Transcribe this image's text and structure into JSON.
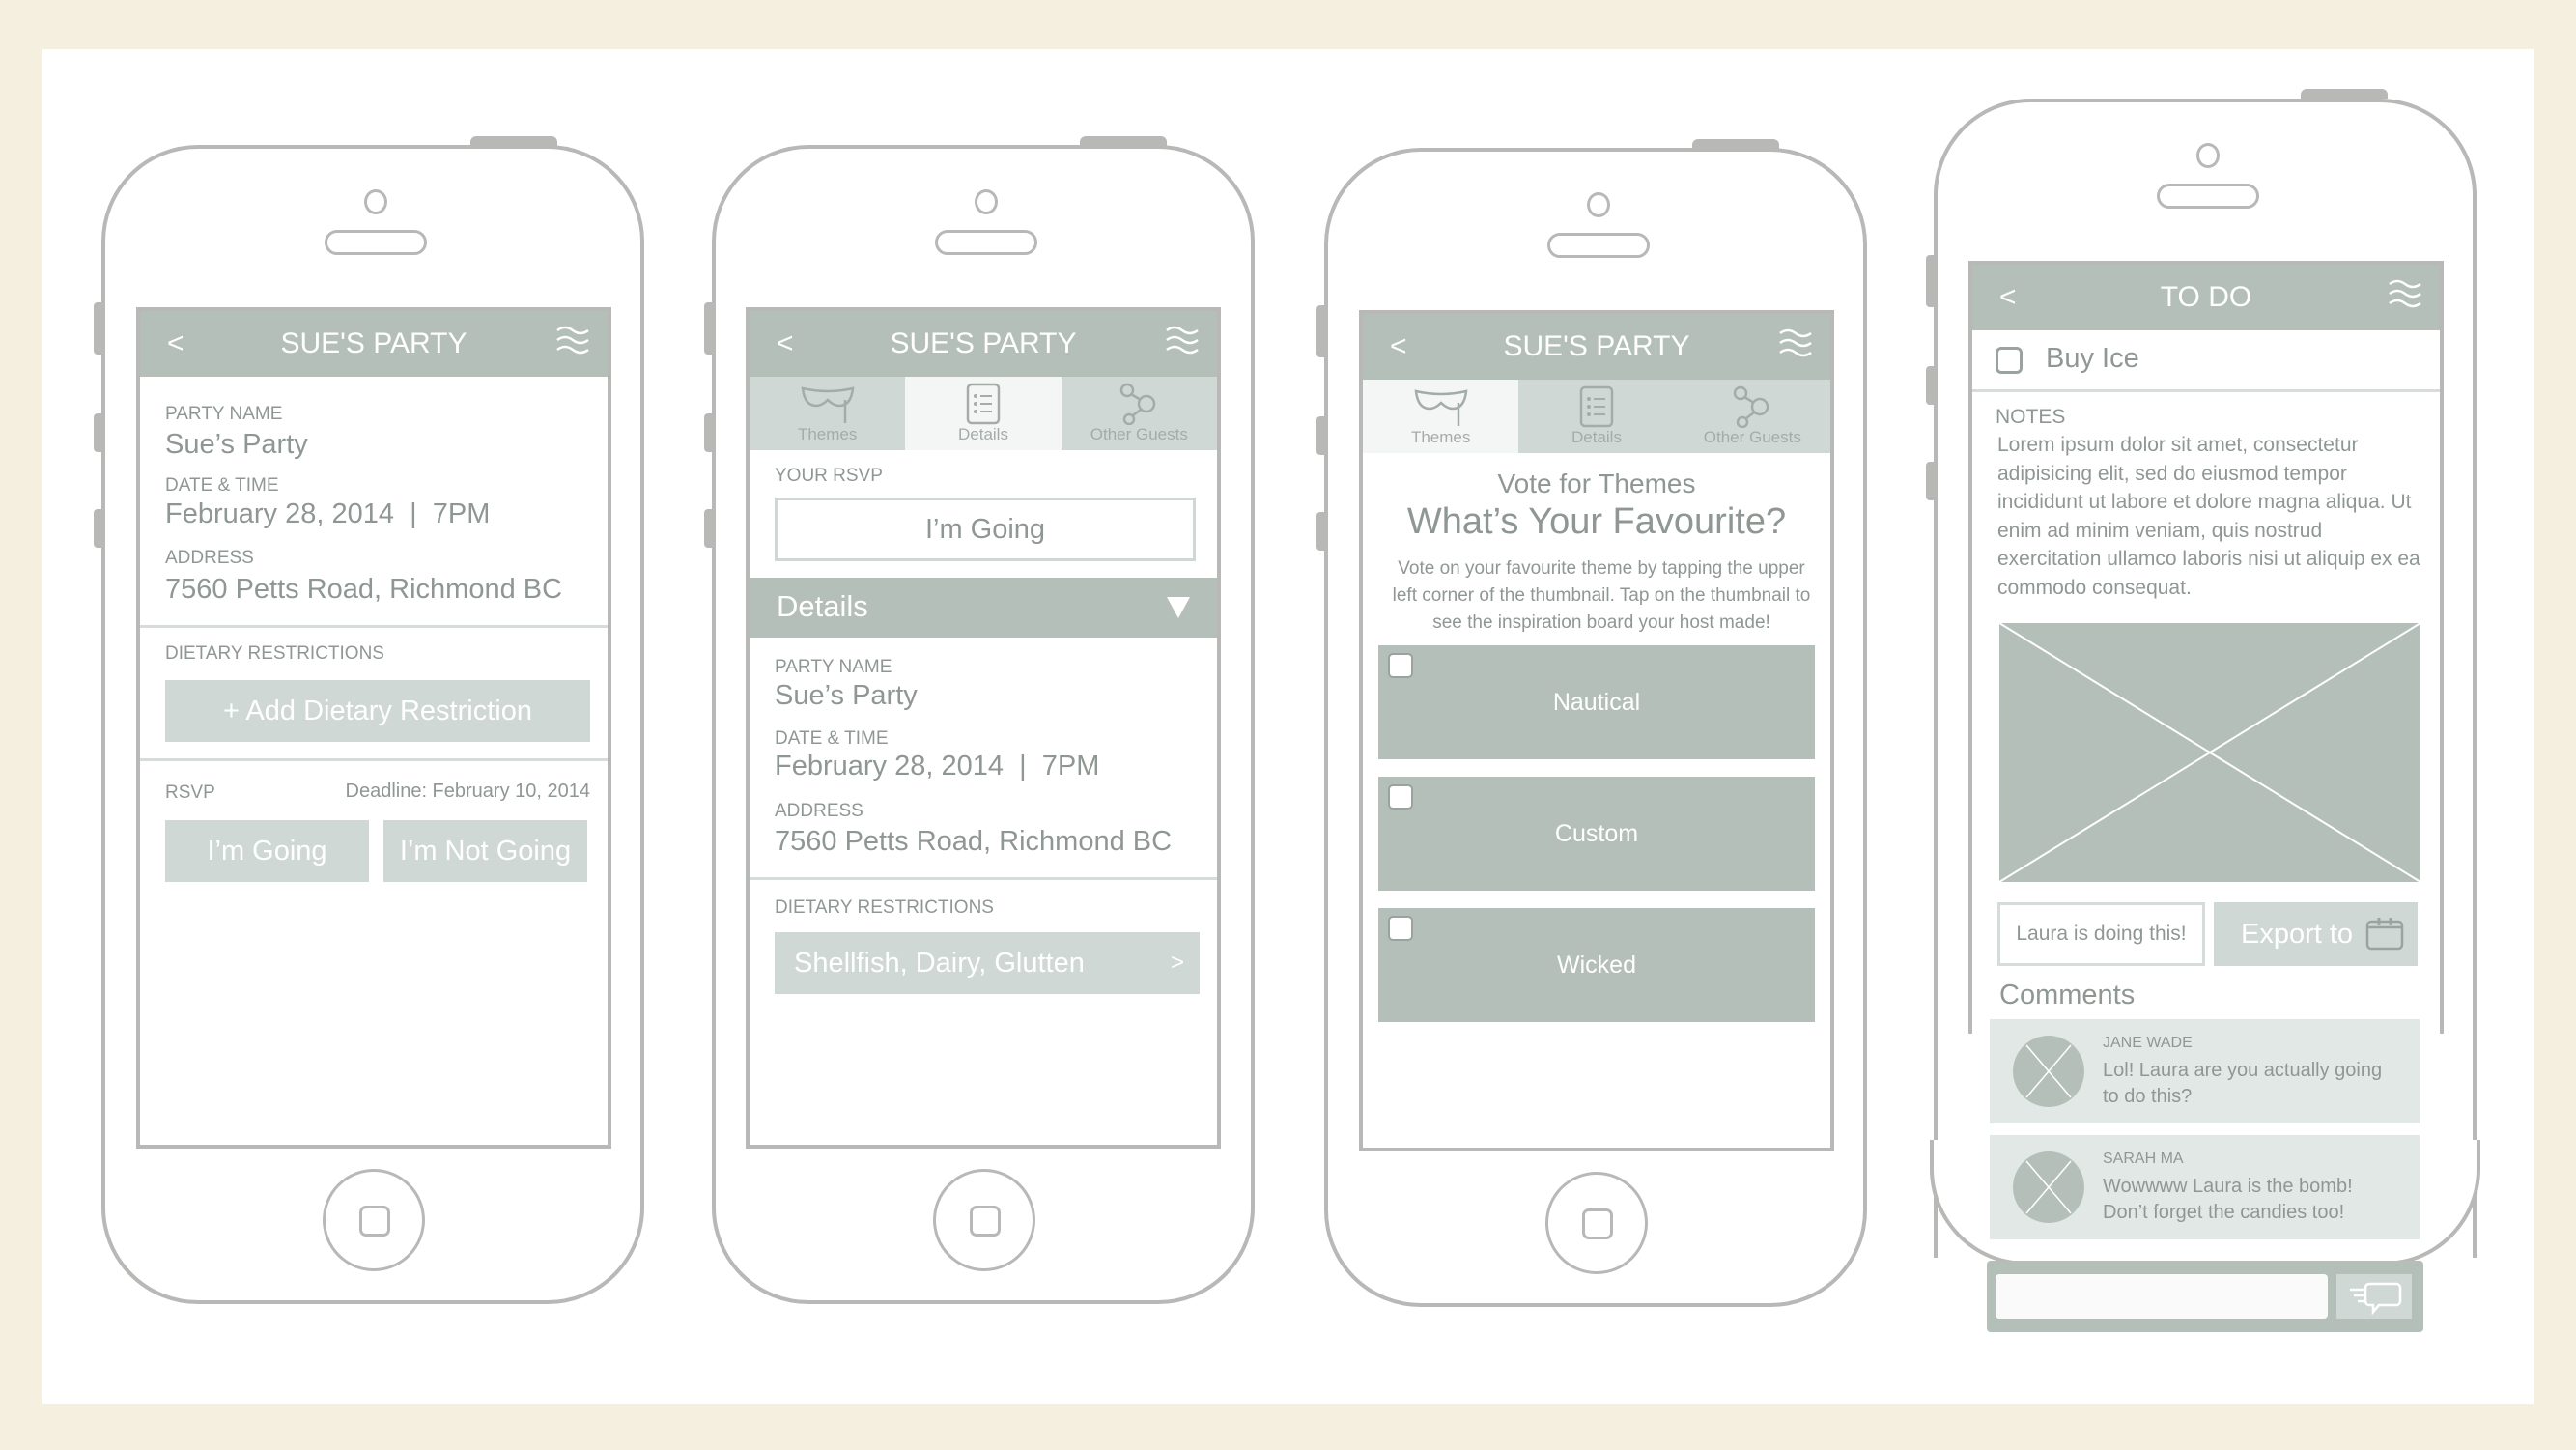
{
  "colors": {
    "background": "#f4efdf",
    "panel": "#ffffff",
    "accent": "#b5bfb9",
    "accent_light": "#d0d8d5",
    "text": "#8f9793",
    "frame": "#b8b8b6"
  },
  "phone1": {
    "header": {
      "title": "SUE'S PARTY",
      "back_icon": "chevron-left",
      "menu_icon": "waves-menu"
    },
    "party_name_label": "PARTY NAME",
    "party_name": "Sue’s Party",
    "date_label": "DATE & TIME",
    "date": "February 28, 2014  |  7PM",
    "address_label": "ADDRESS",
    "address": "7560 Petts Road, Richmond BC",
    "dietary_label": "DIETARY RESTRICTIONS",
    "add_dietary": "+ Add Dietary Restriction",
    "rsvp_label": "RSVP",
    "deadline": "Deadline: February 10, 2014",
    "going": "I’m Going",
    "not_going": "I’m Not Going"
  },
  "phone2": {
    "header": {
      "title": "SUE'S PARTY"
    },
    "tabs": [
      {
        "label": "Themes",
        "icon": "mask"
      },
      {
        "label": "Details",
        "icon": "list"
      },
      {
        "label": "Other Guests",
        "icon": "share-nodes"
      }
    ],
    "active_tab": "Details",
    "rsvp_label": "YOUR RSVP",
    "rsvp_value": "I’m Going",
    "section_title": "Details",
    "party_name_label": "PARTY NAME",
    "party_name": "Sue’s Party",
    "date_label": "DATE & TIME",
    "date": "February 28, 2014  |  7PM",
    "address_label": "ADDRESS",
    "address": "7560 Petts Road, Richmond BC",
    "dietary_label": "DIETARY RESTRICTIONS",
    "dietary_value": "Shellfish, Dairy, Glutten",
    "chevron": ">"
  },
  "phone3": {
    "header": {
      "title": "SUE'S PARTY"
    },
    "tabs": [
      {
        "label": "Themes",
        "icon": "mask"
      },
      {
        "label": "Details",
        "icon": "list"
      },
      {
        "label": "Other Guests",
        "icon": "share-nodes"
      }
    ],
    "active_tab": "Themes",
    "subtitle": "Vote for Themes",
    "title": "What’s Your Favourite?",
    "description": "Vote on your favourite theme by tapping the upper left corner of the thumbnail. Tap on the thumbnail to see the inspiration board your host made!",
    "themes": [
      {
        "name": "Nautical",
        "checked": false
      },
      {
        "name": "Custom",
        "checked": false
      },
      {
        "name": "Wicked",
        "checked": false
      }
    ]
  },
  "phone4": {
    "header": {
      "title": "TO DO"
    },
    "task": {
      "label": "Buy Ice",
      "checked": false
    },
    "notes_label": "NOTES",
    "notes": "Lorem ipsum dolor sit amet, consectetur adipisicing elit, sed do eiusmod tempor incididunt ut labore et dolore magna aliqua. Ut enim ad minim veniam, quis nostrud exercitation ullamco laboris nisi ut aliquip ex ea commodo consequat.",
    "assign_button": "Laura is doing this!",
    "export_button": "Export to",
    "comments_title": "Comments",
    "comments": [
      {
        "author": "JANE WADE",
        "text": "Lol! Laura are you actually going to do this?"
      },
      {
        "author": "SARAH MA",
        "text": "Wowwww Laura is the bomb! Don’t forget the candies too!"
      }
    ],
    "comment_input_placeholder": ""
  }
}
